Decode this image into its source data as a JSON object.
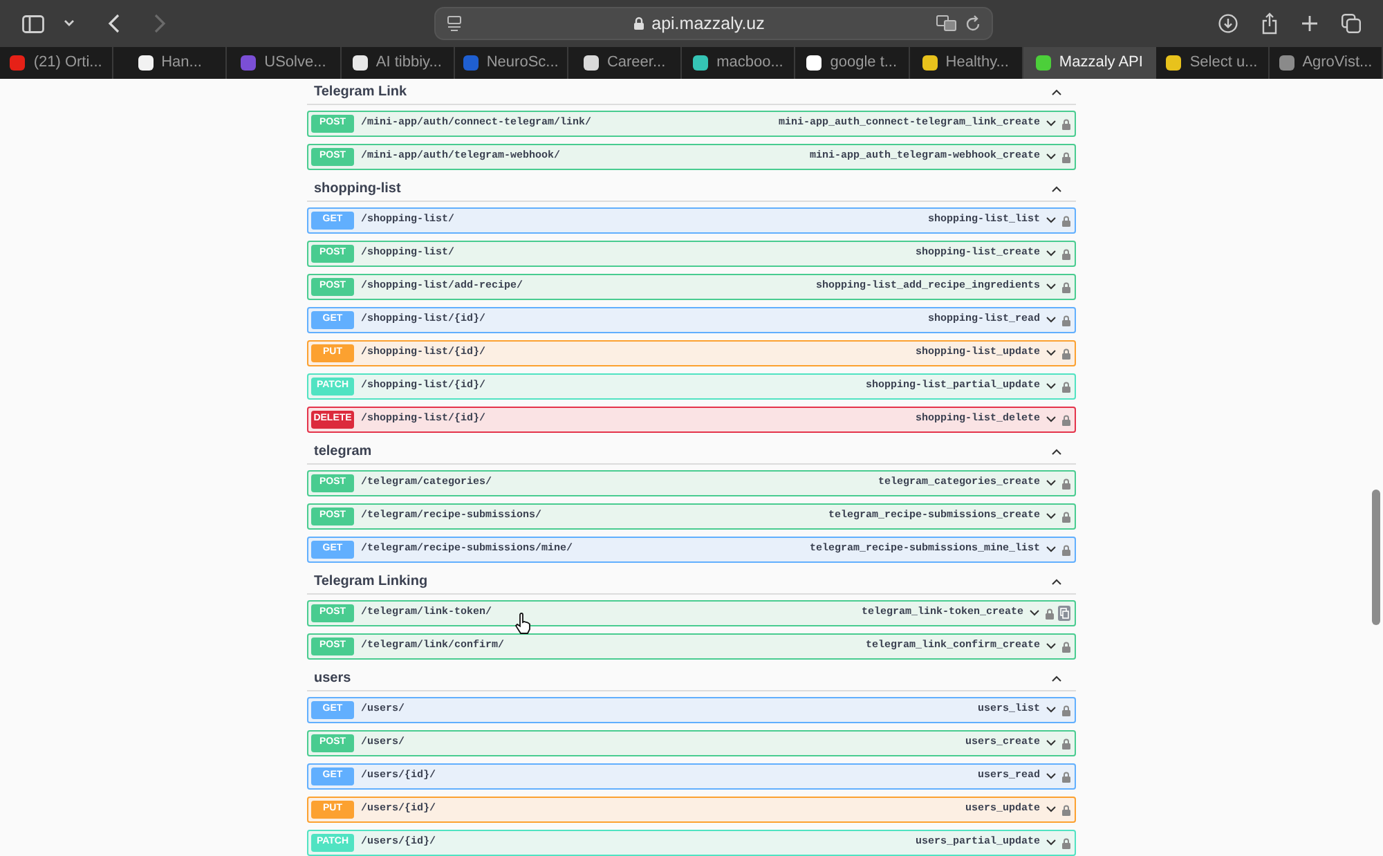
{
  "browser": {
    "address": "api.mazzaly.uz",
    "tabs": [
      {
        "label": "(21) Orti...",
        "selected": false,
        "color": "#e62117"
      },
      {
        "label": "Han...",
        "selected": false,
        "color": "#f2f2f2"
      },
      {
        "label": "USolve...",
        "selected": false,
        "color": "#7b4fd6"
      },
      {
        "label": "AI tibbiy...",
        "selected": false,
        "color": "#e8e8e8"
      },
      {
        "label": "NeuroSc...",
        "selected": false,
        "color": "#1f5fd1"
      },
      {
        "label": "Career...",
        "selected": false,
        "color": "#d9d9d9"
      },
      {
        "label": "macboo...",
        "selected": false,
        "color": "#35c4b5"
      },
      {
        "label": "google t...",
        "selected": false,
        "color": "#ffffff"
      },
      {
        "label": "Healthy...",
        "selected": false,
        "color": "#e8c21c"
      },
      {
        "label": "Mazzaly API",
        "selected": true,
        "color": "#4ccf3a"
      },
      {
        "label": "Select u...",
        "selected": false,
        "color": "#e8c21c"
      },
      {
        "label": "AgroVist...",
        "selected": false,
        "color": "#8a8a8a"
      }
    ]
  },
  "sections": [
    {
      "title": "Telegram Link",
      "expanded": true,
      "operations": [
        {
          "kind": "post",
          "method": "POST",
          "path": "/mini-app/auth/connect-telegram/link/",
          "operation_id": "mini-app_auth_connect-telegram_link_create"
        },
        {
          "kind": "post",
          "method": "POST",
          "path": "/mini-app/auth/telegram-webhook/",
          "operation_id": "mini-app_auth_telegram-webhook_create"
        }
      ]
    },
    {
      "title": "shopping-list",
      "expanded": true,
      "operations": [
        {
          "kind": "get",
          "method": "GET",
          "path": "/shopping-list/",
          "operation_id": "shopping-list_list"
        },
        {
          "kind": "post",
          "method": "POST",
          "path": "/shopping-list/",
          "operation_id": "shopping-list_create"
        },
        {
          "kind": "post",
          "method": "POST",
          "path": "/shopping-list/add-recipe/",
          "operation_id": "shopping-list_add_recipe_ingredients"
        },
        {
          "kind": "get",
          "method": "GET",
          "path": "/shopping-list/{id}/",
          "operation_id": "shopping-list_read"
        },
        {
          "kind": "put",
          "method": "PUT",
          "path": "/shopping-list/{id}/",
          "operation_id": "shopping-list_update"
        },
        {
          "kind": "patch",
          "method": "PATCH",
          "path": "/shopping-list/{id}/",
          "operation_id": "shopping-list_partial_update"
        },
        {
          "kind": "delete",
          "method": "DELETE",
          "path": "/shopping-list/{id}/",
          "operation_id": "shopping-list_delete"
        }
      ]
    },
    {
      "title": "telegram",
      "expanded": true,
      "operations": [
        {
          "kind": "post",
          "method": "POST",
          "path": "/telegram/categories/",
          "operation_id": "telegram_categories_create"
        },
        {
          "kind": "post",
          "method": "POST",
          "path": "/telegram/recipe-submissions/",
          "operation_id": "telegram_recipe-submissions_create"
        },
        {
          "kind": "get",
          "method": "GET",
          "path": "/telegram/recipe-submissions/mine/",
          "operation_id": "telegram_recipe-submissions_mine_list"
        }
      ]
    },
    {
      "title": "Telegram Linking",
      "expanded": true,
      "operations": [
        {
          "kind": "post",
          "method": "POST",
          "path": "/telegram/link-token/",
          "operation_id": "telegram_link-token_create",
          "copy_button": true
        },
        {
          "kind": "post",
          "method": "POST",
          "path": "/telegram/link/confirm/",
          "operation_id": "telegram_link_confirm_create"
        }
      ]
    },
    {
      "title": "users",
      "expanded": true,
      "operations": [
        {
          "kind": "get",
          "method": "GET",
          "path": "/users/",
          "operation_id": "users_list"
        },
        {
          "kind": "post",
          "method": "POST",
          "path": "/users/",
          "operation_id": "users_create"
        },
        {
          "kind": "get",
          "method": "GET",
          "path": "/users/{id}/",
          "operation_id": "users_read"
        },
        {
          "kind": "put",
          "method": "PUT",
          "path": "/users/{id}/",
          "operation_id": "users_update"
        },
        {
          "kind": "patch",
          "method": "PATCH",
          "path": "/users/{id}/",
          "operation_id": "users_partial_update"
        }
      ]
    }
  ]
}
